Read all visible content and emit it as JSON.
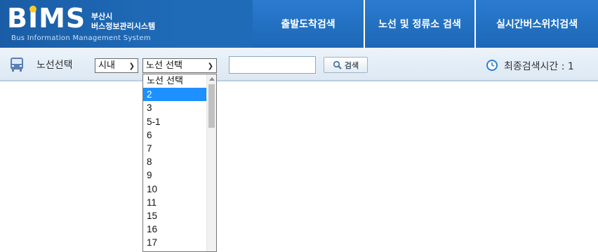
{
  "header": {
    "logo": {
      "brand": "BIMS",
      "korean_line1": "부산시",
      "korean_line2": "버스정보관리시스템",
      "english": "Bus Information Management System"
    },
    "nav": [
      {
        "label": "출발도착검색"
      },
      {
        "label": "노선 및 정류소 검색"
      },
      {
        "label": "실시간버스위치검색"
      }
    ]
  },
  "search_bar": {
    "label": "노선선택",
    "city_select": {
      "value": "시내"
    },
    "route_select": {
      "value": "노선 선택"
    },
    "search_input": {
      "value": ""
    },
    "search_button": {
      "label": "검색"
    },
    "last_search_text": "최종검색시간 : 1"
  },
  "dropdown": {
    "options": [
      "노선 선택",
      "2",
      "3",
      "5-1",
      "6",
      "7",
      "8",
      "9",
      "10",
      "11",
      "15",
      "16",
      "17"
    ],
    "highlighted": "2"
  },
  "colors": {
    "header_blue": "#1d6cbc",
    "highlight": "#1e90ff",
    "logo_dot": "#ffc928"
  }
}
